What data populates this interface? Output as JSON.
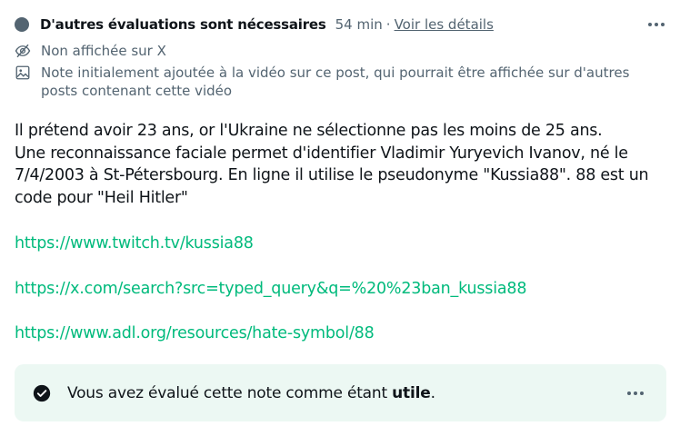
{
  "header": {
    "status_title": "D'autres évaluations sont nécessaires",
    "time": "54 min",
    "separator": "·",
    "details_link": "Voir les détails"
  },
  "info": {
    "hidden_text": "Non affichée sur X",
    "media_text": "Note initialement ajoutée à la vidéo sur ce post, qui pourrait être affichée sur d'autres posts contenant cette vidéo"
  },
  "note": {
    "line1": "Il prétend avoir 23 ans, or l'Ukraine ne sélectionne pas les moins de 25 ans.",
    "line2": "Une reconnaissance faciale permet d'identifier Vladimir Yuryevich Ivanov, né le 7/4/2003 à St-Pétersbourg. En ligne il utilise le pseudonyme \"Kussia88\". 88 est un code pour \"Heil Hitler\"",
    "links": [
      "https://www.twitch.tv/kussia88",
      "https://x.com/search?src=typed_query&q=%20%23ban_kussia88",
      "https://www.adl.org/resources/hate-symbol/88"
    ]
  },
  "rating": {
    "prefix": "Vous avez évalué cette note comme étant ",
    "value": "utile",
    "suffix": "."
  },
  "icons": {
    "status": "status-dot-icon",
    "hidden": "eye-slash-icon",
    "media": "image-icon",
    "check": "check-circle-icon",
    "more": "more-horizontal-icon"
  },
  "colors": {
    "text": "#0f1419",
    "secondary": "#536471",
    "link": "#00ba7c",
    "rating_bg": "#ecf8f3"
  }
}
